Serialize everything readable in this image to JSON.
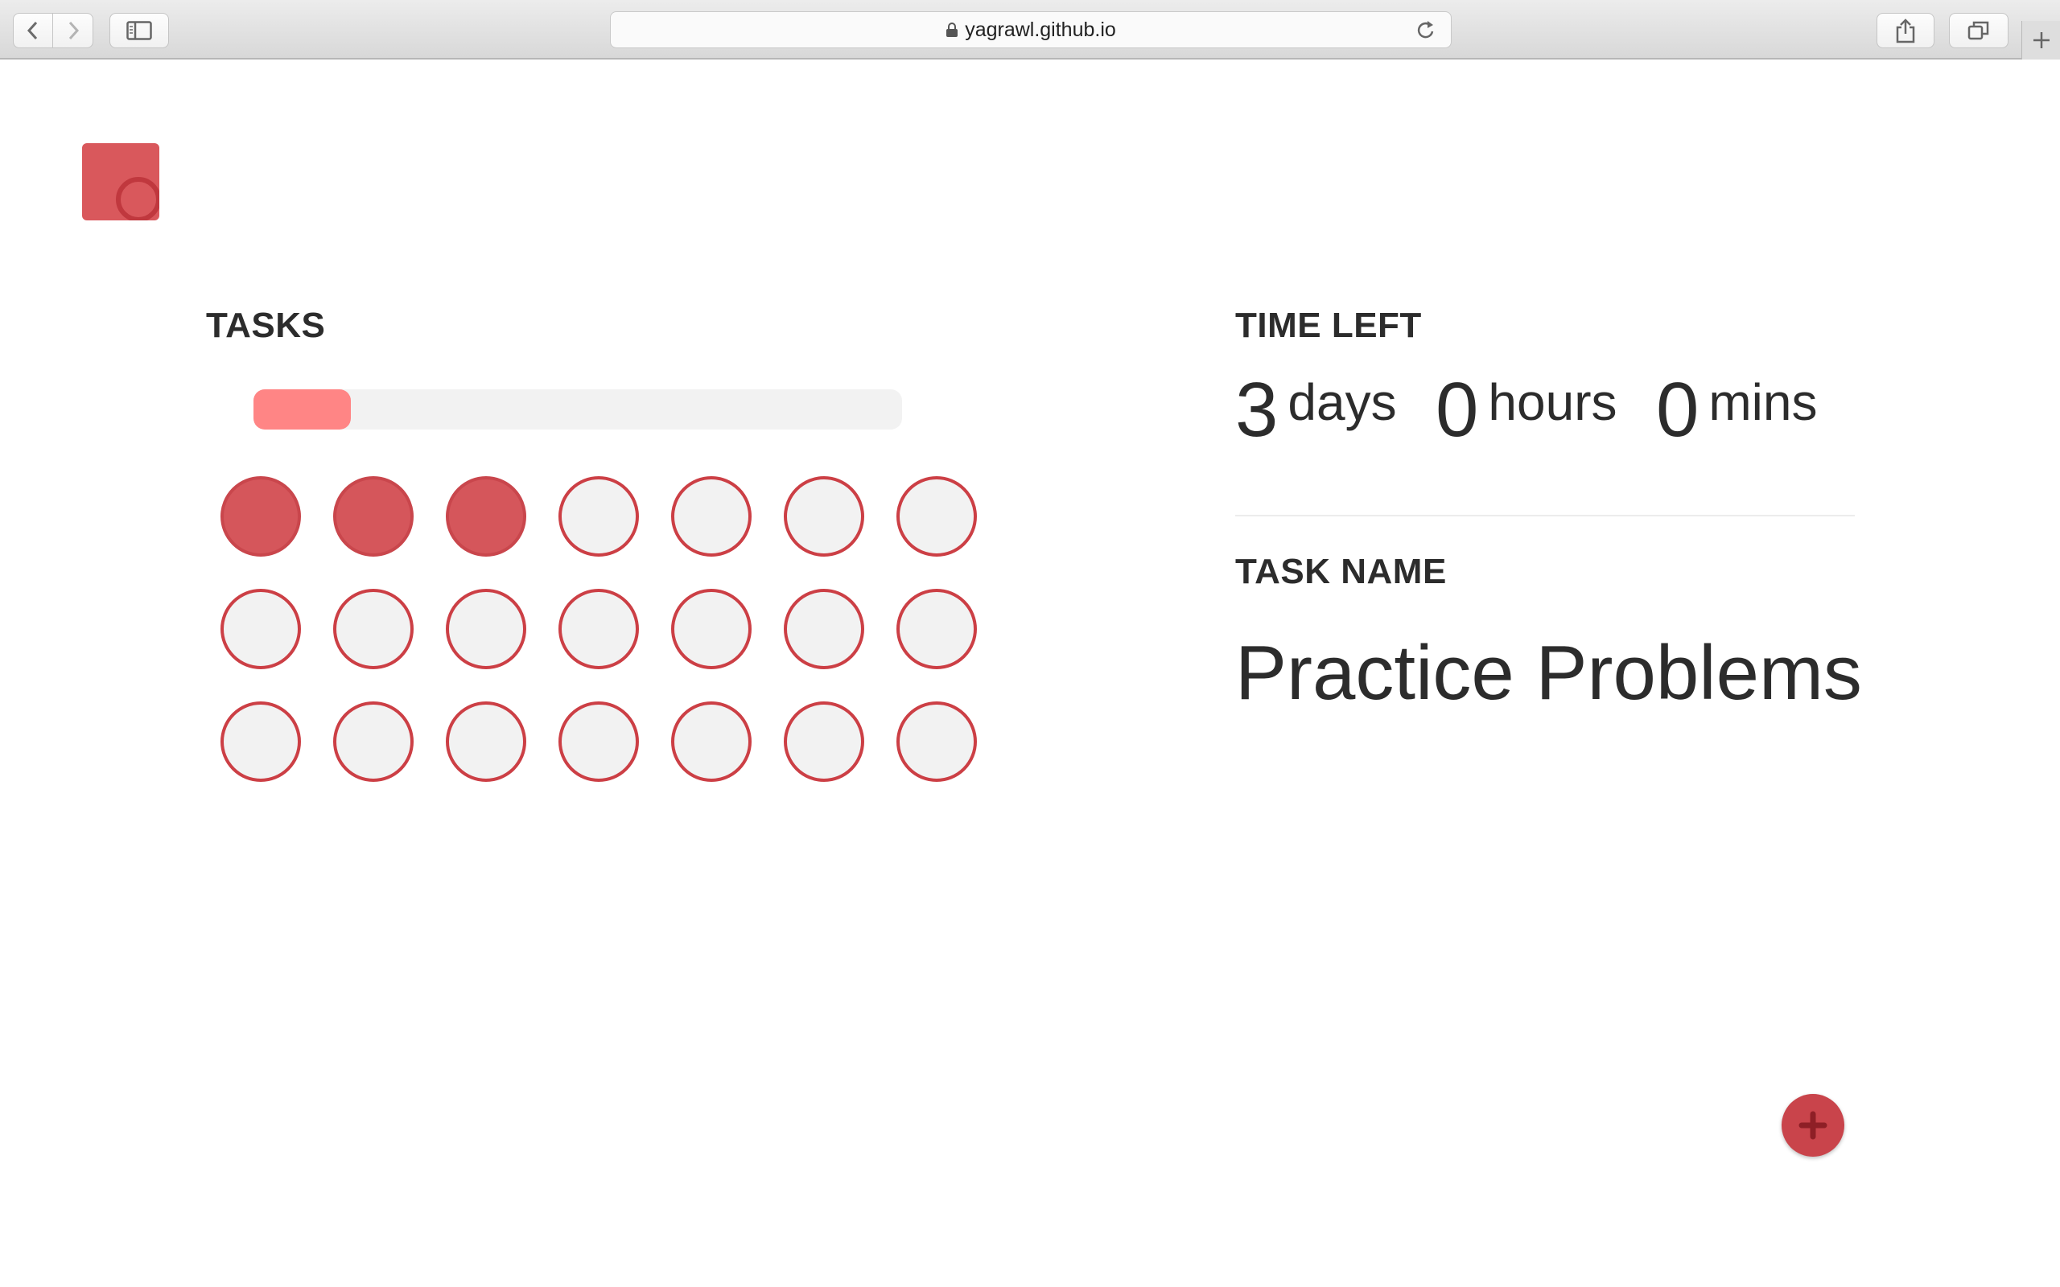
{
  "browser": {
    "url": "yagrawl.github.io",
    "icons": {
      "back": "chevron-left-icon",
      "forward": "chevron-right-icon",
      "sidebar": "sidebar-icon",
      "lock": "lock-icon",
      "reload": "reload-icon",
      "share": "share-icon",
      "tabs": "tabs-icon",
      "new_tab": "plus-icon"
    }
  },
  "app": {
    "logo_icon": "app-logo-icon",
    "accent_color": "#d5565b",
    "progress_color": "#ff8585"
  },
  "tasks": {
    "title": "TASKS",
    "progress_fraction": 0.15,
    "total": 21,
    "completed": 3
  },
  "time_left": {
    "title": "TIME LEFT",
    "days_value": "3",
    "days_unit": "days",
    "hours_value": "0",
    "hours_unit": "hours",
    "mins_value": "0",
    "mins_unit": "mins"
  },
  "task": {
    "title": "TASK NAME",
    "name": "Practice Problems"
  },
  "fab": {
    "icon": "plus-icon"
  }
}
